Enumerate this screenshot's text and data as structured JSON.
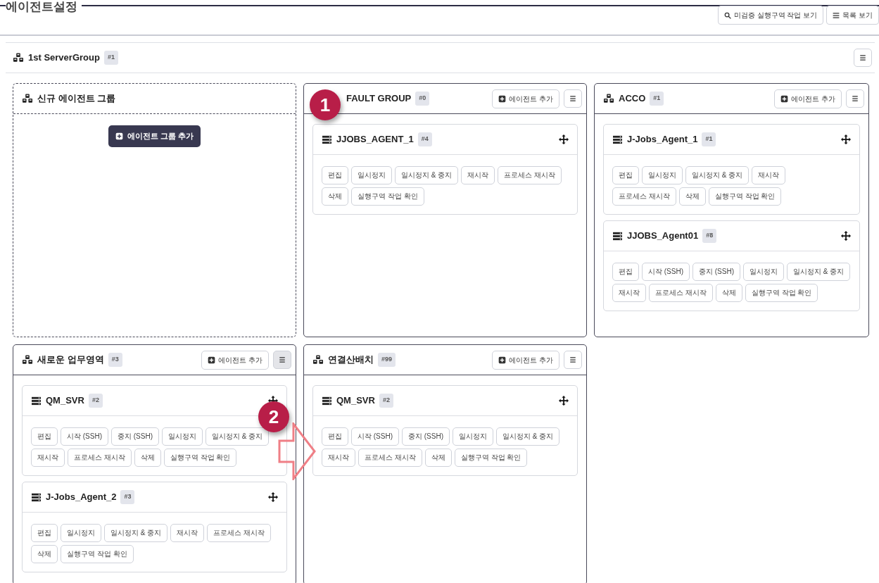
{
  "page": {
    "title": "에이전트설정",
    "buttons": [
      {
        "label": "미검증 실행구역 작업 보기"
      },
      {
        "label": "목록 보기"
      }
    ]
  },
  "server_group": {
    "name": "1st ServerGroup",
    "badge": "#1"
  },
  "groups": [
    {
      "kind": "new",
      "title": "신규 에이전트 그룹",
      "add_group_button": "에이전트 그룹 추가"
    },
    {
      "kind": "group",
      "title": "FAULT GROUP",
      "badge": "#0",
      "add_button": "에이전트 추가",
      "menu_active": false,
      "callout": "1",
      "agents": [
        {
          "name": "JJOBS_AGENT_1",
          "badge": "#4",
          "actions": [
            "편집",
            "일시정지",
            "일시정지 & 중지",
            "재시작",
            "프로세스 재시작",
            "삭제",
            "실행구역 작업 확인"
          ]
        }
      ]
    },
    {
      "kind": "group",
      "title": "ACCO",
      "badge": "#1",
      "add_button": "에이전트 추가",
      "menu_active": false,
      "agents": [
        {
          "name": "J-Jobs_Agent_1",
          "badge": "#1",
          "actions": [
            "편집",
            "일시정지",
            "일시정지 & 중지",
            "재시작",
            "프로세스 재시작",
            "삭제",
            "실행구역 작업 확인"
          ]
        },
        {
          "name": "JJOBS_Agent01",
          "badge": "#8",
          "actions": [
            "편집",
            "시작 (SSH)",
            "중지 (SSH)",
            "일시정지",
            "일시정지 & 중지",
            "재시작",
            "프로세스 재시작",
            "삭제",
            "실행구역 작업 확인"
          ]
        }
      ]
    },
    {
      "kind": "group",
      "title": "새로운 업무영역",
      "badge": "#3",
      "add_button": "에이전트 추가",
      "menu_active": true,
      "agents": [
        {
          "name": "QM_SVR",
          "badge": "#2",
          "callout": "2",
          "arrow": true,
          "actions": [
            "편집",
            "시작 (SSH)",
            "중지 (SSH)",
            "일시정지",
            "일시정지 & 중지",
            "재시작",
            "프로세스 재시작",
            "삭제",
            "실행구역 작업 확인"
          ]
        },
        {
          "name": "J-Jobs_Agent_2",
          "badge": "#3",
          "actions": [
            "편집",
            "일시정지",
            "일시정지 & 중지",
            "재시작",
            "프로세스 재시작",
            "삭제",
            "실행구역 작업 확인"
          ]
        }
      ]
    },
    {
      "kind": "group",
      "title": "연결산배치",
      "badge": "#99",
      "add_button": "에이전트 추가",
      "menu_active": false,
      "agents": [
        {
          "name": "QM_SVR",
          "badge": "#2",
          "actions": [
            "편집",
            "시작 (SSH)",
            "중지 (SSH)",
            "일시정지",
            "일시정지 & 중지",
            "재시작",
            "프로세스 재시작",
            "삭제",
            "실행구역 작업 확인"
          ]
        }
      ]
    }
  ]
}
